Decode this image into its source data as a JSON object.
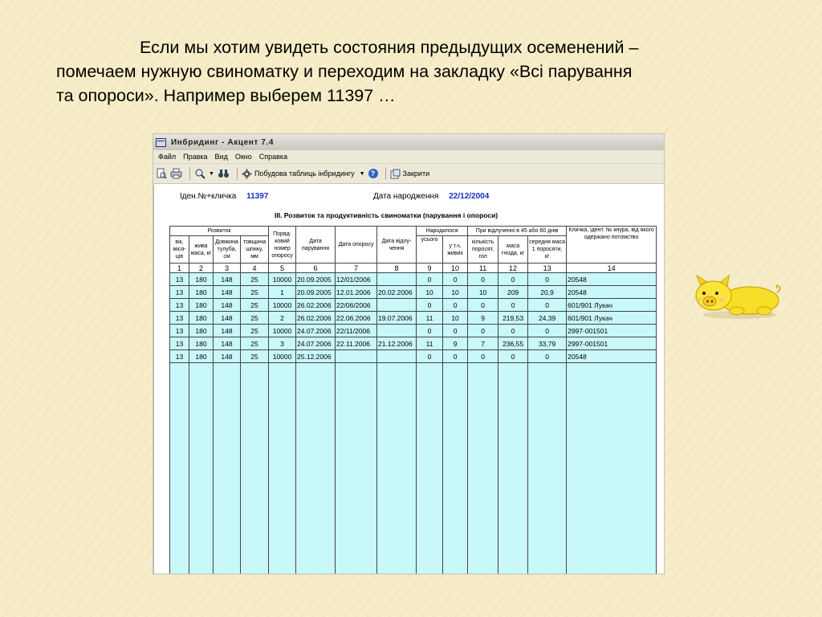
{
  "slide": {
    "text_line1": "Если мы хотим увидеть состояния предыдущих осеменений –",
    "text_line2": "помечаем нужную свиноматку и переходим на закладку «Всі парування",
    "text_line3": "та опороси». Например выберем 11397 …"
  },
  "window": {
    "title": "Инбридинг - Акцент 7.4",
    "menu": [
      "Файл",
      "Правка",
      "Вид",
      "Окно",
      "Справка"
    ],
    "toolbar": {
      "build_label": "Побудова таблиць інбридингу",
      "close_label": "Закрити"
    }
  },
  "record": {
    "id_label": "Іден.№+кличка",
    "id_value": "11397",
    "birth_label": "Дата народження",
    "birth_value": "22/12/2004",
    "section_title": "ІІІ. Розвиток та продуктивність свиноматки (парування і опороси)"
  },
  "table": {
    "group_headers": {
      "development": "Розвиток",
      "born": "Народилося",
      "weaning": "При відлученні в 45 або 60 днів"
    },
    "columns": [
      "вік, міся-ців",
      "жива маса, кг",
      "Довжина тулуба, см",
      "товщина шпику, мм",
      "Поряд-ковий номер опоросу",
      "Дата парування",
      "Дата опоросу",
      "Дата відлу-чення",
      "усього",
      "у т.ч. живих",
      "кількість поросят, гол",
      "маса гнізда, кг",
      "середня маса 1 поросяти, кг",
      "Кличка, ідент. № кнура, від якого одержано потомство"
    ],
    "column_numbers": [
      "1",
      "2",
      "3",
      "4",
      "5",
      "6",
      "7",
      "8",
      "9",
      "10",
      "11",
      "12",
      "13",
      "14"
    ],
    "rows": [
      [
        "13",
        "180",
        "148",
        "25",
        "10000",
        "20.09.2005",
        "12/01/2006",
        "",
        "0",
        "0",
        "0",
        "0",
        "0",
        "20548"
      ],
      [
        "13",
        "180",
        "148",
        "25",
        "1",
        "20.09.2005",
        "12.01.2006",
        "20.02.2006",
        "10",
        "10",
        "10",
        "209",
        "20,9",
        "20548"
      ],
      [
        "13",
        "180",
        "148",
        "25",
        "10000",
        "26.02.2006",
        "22/06/2006",
        "",
        "0",
        "0",
        "0",
        "0",
        "0",
        "601/901 Лукач"
      ],
      [
        "13",
        "180",
        "148",
        "25",
        "2",
        "26.02.2006",
        "22.06.2006",
        "19.07.2006",
        "11",
        "10",
        "9",
        "219,53",
        "24,39",
        "601/901 Лукач"
      ],
      [
        "13",
        "180",
        "148",
        "25",
        "10000",
        "24.07.2006",
        "22/11/2006",
        "",
        "0",
        "0",
        "0",
        "0",
        "0",
        "2997-001501"
      ],
      [
        "13",
        "180",
        "148",
        "25",
        "3",
        "24.07.2006",
        "22.11.2006",
        "21.12.2006",
        "11",
        "9",
        "7",
        "236,55",
        "33,79",
        "2997-001501"
      ],
      [
        "13",
        "180",
        "148",
        "25",
        "10000",
        "25.12.2006",
        "",
        "",
        "0",
        "0",
        "0",
        "0",
        "0",
        "20548"
      ]
    ]
  }
}
